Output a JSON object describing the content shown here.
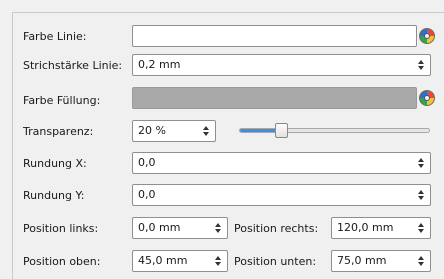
{
  "fields": {
    "farbe_linie": {
      "label": "Farbe Linie:",
      "value": ""
    },
    "strichstaerke": {
      "label": "Strichstärke Linie:",
      "value": "0,2 mm"
    },
    "farbe_fuellung": {
      "label": "Farbe Füllung:",
      "value": ""
    },
    "transparenz": {
      "label": "Transparenz:",
      "value": "20 %",
      "slider_percent": 20
    },
    "rundung_x": {
      "label": "Rundung X:",
      "value": "0,0"
    },
    "rundung_y": {
      "label": "Rundung Y:",
      "value": "0,0"
    },
    "position_links": {
      "label": "Position links:",
      "value": "0,0 mm"
    },
    "position_rechts": {
      "label": "Position rechts:",
      "value": "120,0 mm"
    },
    "position_oben": {
      "label": "Position oben:",
      "value": "45,0 mm"
    },
    "position_unten": {
      "label": "Position unten:",
      "value": "75,0 mm"
    }
  },
  "colors": {
    "accent": "#3d8ee8",
    "disabled_fill": "#a9a9a9"
  },
  "icons": {
    "color_picker": "color-wheel-icon"
  }
}
